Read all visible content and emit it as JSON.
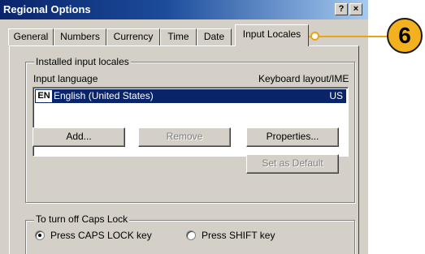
{
  "window": {
    "title": "Regional Options",
    "help_label": "?",
    "close_label": "×"
  },
  "tabs": [
    {
      "label": "General"
    },
    {
      "label": "Numbers"
    },
    {
      "label": "Currency"
    },
    {
      "label": "Time"
    },
    {
      "label": "Date"
    },
    {
      "label": "Input Locales",
      "active": true
    }
  ],
  "installed_locales": {
    "group_label": "Installed input locales",
    "col_language": "Input language",
    "col_layout": "Keyboard layout/IME",
    "items": [
      {
        "code": "EN",
        "language": "English (United States)",
        "layout": "US",
        "selected": true
      }
    ],
    "buttons": {
      "add": "Add...",
      "remove": "Remove",
      "properties": "Properties...",
      "set_default": "Set as Default"
    }
  },
  "caps_lock": {
    "group_label": "To turn off Caps Lock",
    "option_caps": "Press CAPS LOCK key",
    "option_shift": "Press SHIFT key",
    "selected": "caps"
  },
  "callout": {
    "number": "6",
    "color": "#f3b120"
  }
}
